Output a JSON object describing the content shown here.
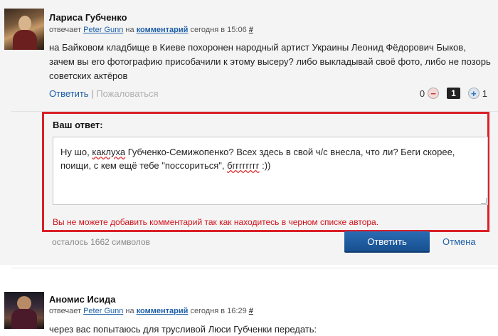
{
  "comment1": {
    "author": "Лариса Губченко",
    "meta": {
      "replies_word": "отвечает",
      "reply_to": "Peter Gunn",
      "on_word": "на",
      "target": "комментарий",
      "time": "сегодня в 15:06",
      "hash": "#"
    },
    "text": "на Байковом кладбище в Киеве похоронен народный артист Украины Леонид Фёдорович Быков, зачем вы его фотографию присобачили к этому высеру? либо выкладывай своё фото, либо не позорь советских актёров",
    "actions": {
      "reply": "Ответить",
      "separator": "|",
      "complain": "Пожаловаться"
    },
    "vote": {
      "down_count": "0",
      "down_icon": "−",
      "score": "1",
      "up_icon": "+",
      "up_count": "1"
    }
  },
  "reply_form": {
    "title": "Ваш ответ:",
    "text_part1": "Ну шо, ",
    "text_sq1": "каклуха",
    "text_part2": " Губченко-Семижопенко? Всех здесь в свой ч/с внесла, что ли? Беги скорее, поищи, с кем ещё тебе \"поссориться\", ",
    "text_sq2": "бгггггггг",
    "text_part3": " :))",
    "error": "Вы не можете добавить комментарий так как находитесь в черном списке автора.",
    "remaining": "осталось 1662 символов",
    "submit": "Ответить",
    "cancel": "Отмена",
    "accent_color": "#d92028",
    "button_color": "#1f5fa3"
  },
  "comment2": {
    "author": "Аномис Исида",
    "meta": {
      "replies_word": "отвечает",
      "reply_to": "Peter Gunn",
      "on_word": "на",
      "target": "комментарий",
      "time": "сегодня в 16:29",
      "hash": "#"
    },
    "text": "через вас попытаюсь для трусливой Люси Губченки передать:"
  }
}
